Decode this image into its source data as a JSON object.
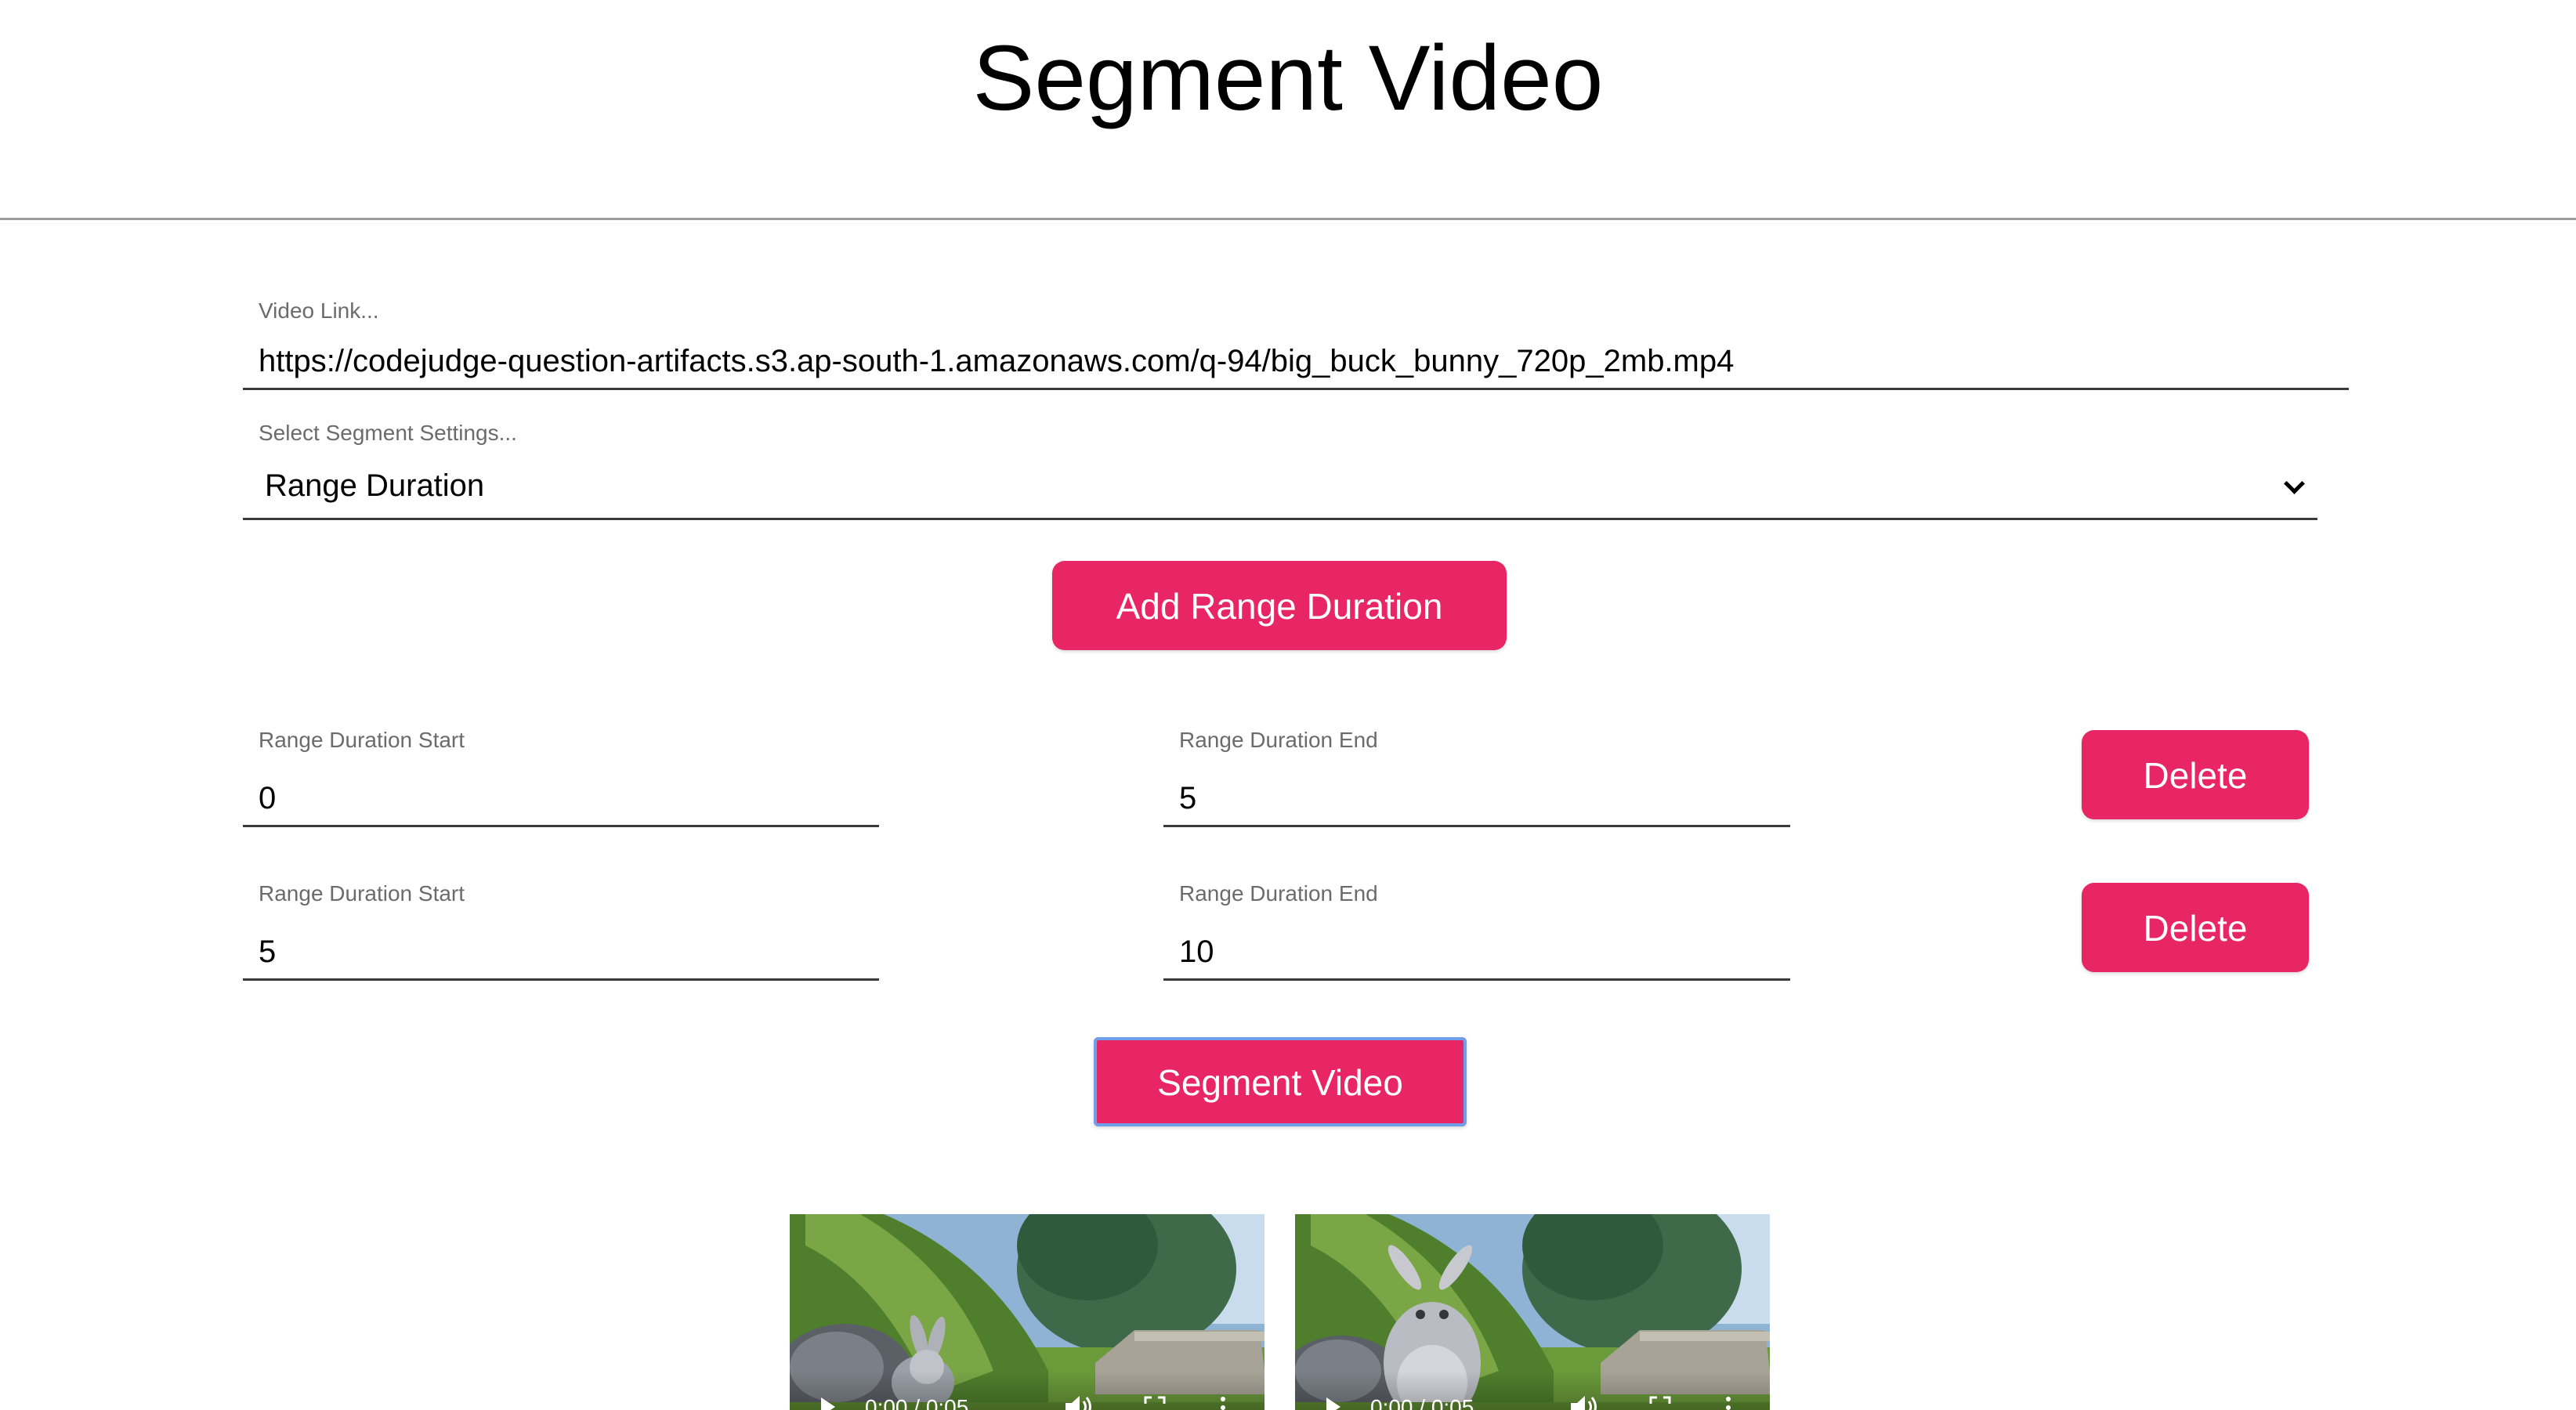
{
  "page": {
    "title": "Segment Video"
  },
  "form": {
    "video_link": {
      "label": "Video Link...",
      "value": "https://codejudge-question-artifacts.s3.ap-south-1.amazonaws.com/q-94/big_buck_bunny_720p_2mb.mp4"
    },
    "segment_settings": {
      "label": "Select Segment Settings...",
      "selected": "Range Duration"
    },
    "add_range_button": "Add Range Duration",
    "ranges": [
      {
        "start_label": "Range Duration Start",
        "start_value": "0",
        "end_label": "Range Duration End",
        "end_value": "5",
        "delete_label": "Delete"
      },
      {
        "start_label": "Range Duration Start",
        "start_value": "5",
        "end_label": "Range Duration End",
        "end_value": "10",
        "delete_label": "Delete"
      }
    ],
    "segment_button": "Segment Video"
  },
  "videos": [
    {
      "time": "0:00 / 0:05"
    },
    {
      "time": "0:00 / 0:05"
    }
  ],
  "colors": {
    "accent": "#e82565",
    "focus_ring": "#6f9fe8"
  },
  "icons": [
    "play-icon",
    "volume-icon",
    "fullscreen-icon",
    "more-options-icon",
    "chevron-down-icon"
  ]
}
